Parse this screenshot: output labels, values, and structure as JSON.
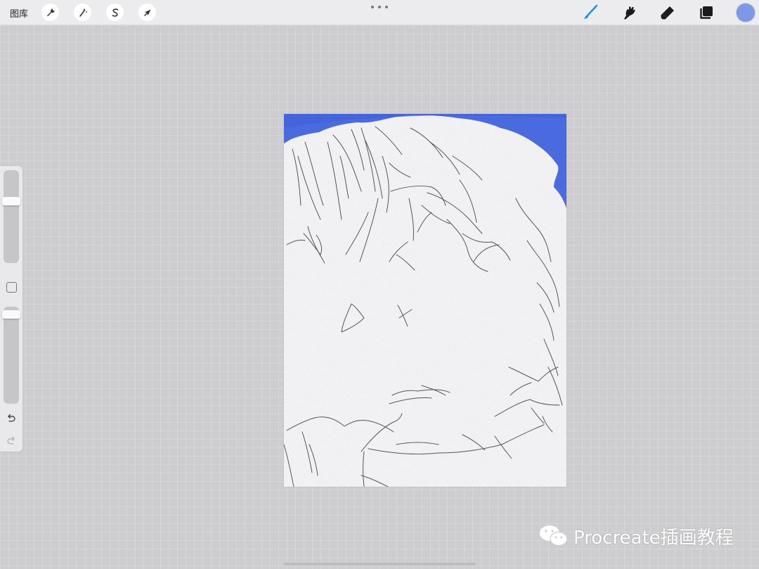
{
  "topbar": {
    "gallery_label": "图库",
    "left_tools": [
      {
        "icon": "wrench-icon",
        "name": "actions"
      },
      {
        "icon": "magic-wand-icon",
        "name": "adjustments"
      },
      {
        "icon": "selection-s-icon",
        "name": "selection"
      },
      {
        "icon": "arrow-cursor-icon",
        "name": "transform"
      }
    ],
    "right_tools": [
      {
        "icon": "brush-icon",
        "name": "paint",
        "active": true,
        "color": "#1f8ff0"
      },
      {
        "icon": "smudge-icon",
        "name": "smudge"
      },
      {
        "icon": "eraser-icon",
        "name": "erase"
      },
      {
        "icon": "layers-icon",
        "name": "layers"
      }
    ],
    "current_color": "#7f97e8"
  },
  "sidebar": {
    "brush_size_level": 0.3,
    "opacity_level": 0.05
  },
  "canvas": {
    "sky_color": "#4a6be0",
    "paper_color": "#f3f3f5"
  },
  "watermark": {
    "icon": "wechat-icon",
    "text": "Procreate插画教程"
  }
}
